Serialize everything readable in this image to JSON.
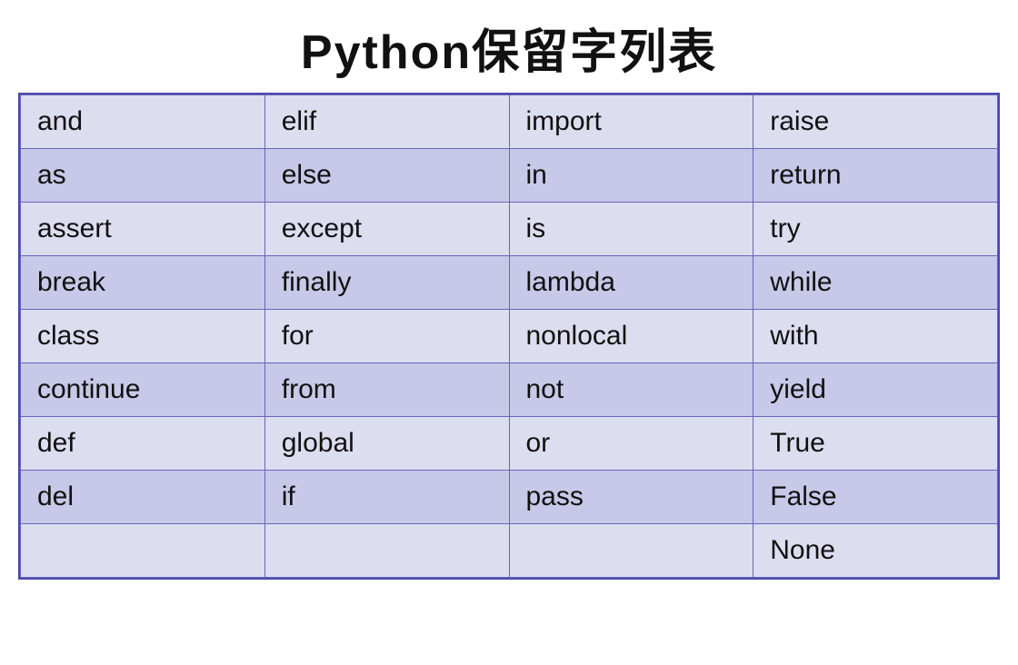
{
  "title": "Python保留字列表",
  "rows": [
    [
      "and",
      "elif",
      "import",
      "raise"
    ],
    [
      "as",
      "else",
      "in",
      "return"
    ],
    [
      "assert",
      "except",
      "is",
      "try"
    ],
    [
      "break",
      "finally",
      "lambda",
      "while"
    ],
    [
      "class",
      "for",
      "nonlocal",
      "with"
    ],
    [
      "continue",
      "from",
      "not",
      "yield"
    ],
    [
      "def",
      "global",
      "or",
      "True"
    ],
    [
      "del",
      "if",
      "pass",
      "False"
    ],
    [
      "",
      "",
      "",
      "None"
    ]
  ]
}
